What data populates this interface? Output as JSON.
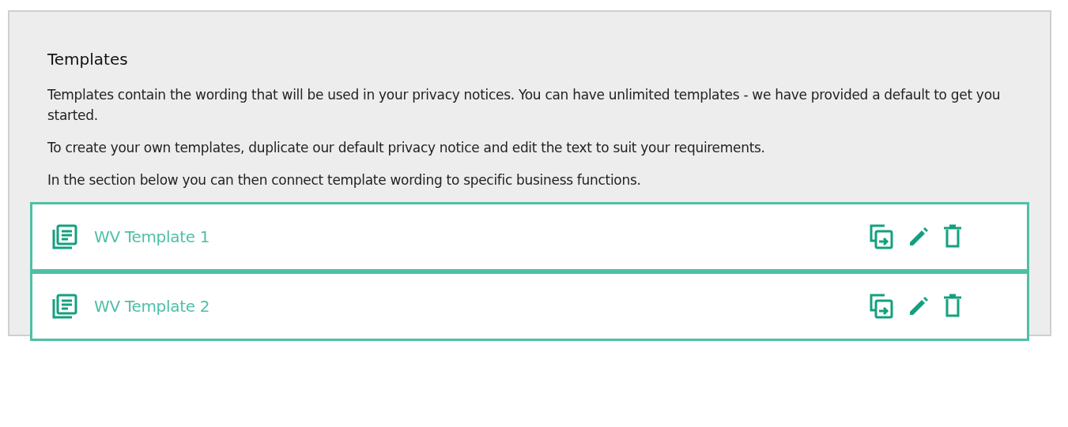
{
  "panel": {
    "title": "Templates",
    "paragraphs": [
      "Templates contain the wording that will be used in your privacy notices. You can have unlimited templates - we have provided a default to get you started.",
      "To create your own templates, duplicate our default privacy notice and edit the text to suit your requirements.",
      "In the section below you can then connect template wording to specific business functions."
    ]
  },
  "templates": [
    {
      "name": "WV Template 1"
    },
    {
      "name": "WV Template 2"
    }
  ]
}
